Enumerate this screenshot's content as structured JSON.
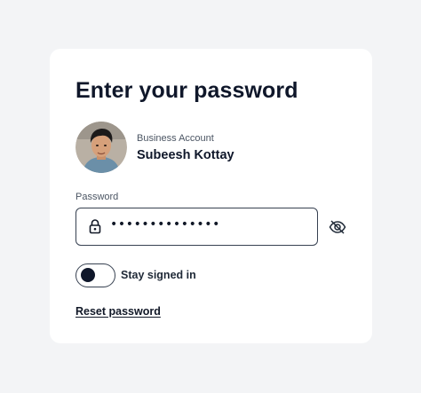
{
  "card": {
    "title": "Enter your password"
  },
  "account": {
    "type_label": "Business Account",
    "name": "Subeesh Kottay"
  },
  "password": {
    "label": "Password",
    "masked_value": "••••••••••••••",
    "show_hide_icon": "eye-slash-icon",
    "field_icon": "lock-icon"
  },
  "stay_signed_in": {
    "label": "Stay signed in",
    "checked": false
  },
  "links": {
    "reset_password": "Reset password"
  },
  "colors": {
    "background": "#f3f4f6",
    "card": "#ffffff",
    "text": "#0f172a",
    "border": "#374151"
  }
}
